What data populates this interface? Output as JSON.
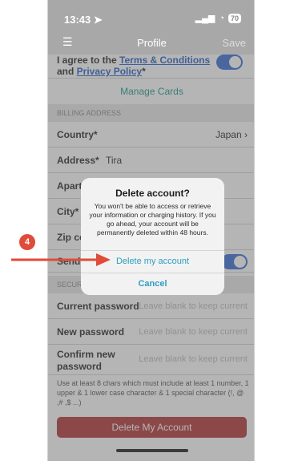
{
  "status": {
    "time": "13:43",
    "battery": "70"
  },
  "nav": {
    "title": "Profile",
    "save": "Save"
  },
  "terms": {
    "prefix": "I agree to the ",
    "terms_link": "Terms & Conditions",
    "and": " and ",
    "privacy_link": "Privacy Policy",
    "suffix": "*"
  },
  "manage_cards": "Manage Cards",
  "billing": {
    "header": "BILLING ADDRESS",
    "country_label": "Country*",
    "country_value": "Japan",
    "address_label": "Address*",
    "address_value": "Tira",
    "apartment_label": "Apart",
    "city_label": "City*",
    "zip_label": "Zip co",
    "send_label": "Send"
  },
  "security": {
    "header": "SECUR",
    "current_label": "Current password",
    "new_label": "New password",
    "confirm_label": "Confirm new password",
    "placeholder": "Leave blank to keep current",
    "rules": "Use at least 8 chars which must include at least 1 number, 1 upper & 1 lower case character & 1 special character (!, @ ,# ,$ ...)"
  },
  "delete_button": "Delete My Account",
  "dialog": {
    "title": "Delete account?",
    "message": "You won't be able to access or retrieve your information or charging history. If you go ahead, your account will be permanently deleted within 48 hours.",
    "confirm": "Delete my account",
    "cancel": "Cancel"
  },
  "annotation": {
    "step": "4",
    "color": "#e04b3a"
  },
  "colors": {
    "accent": "#2b9fbf",
    "danger": "#b43a3a",
    "toggle": "#3b6fd6",
    "link": "#2a63c9"
  }
}
